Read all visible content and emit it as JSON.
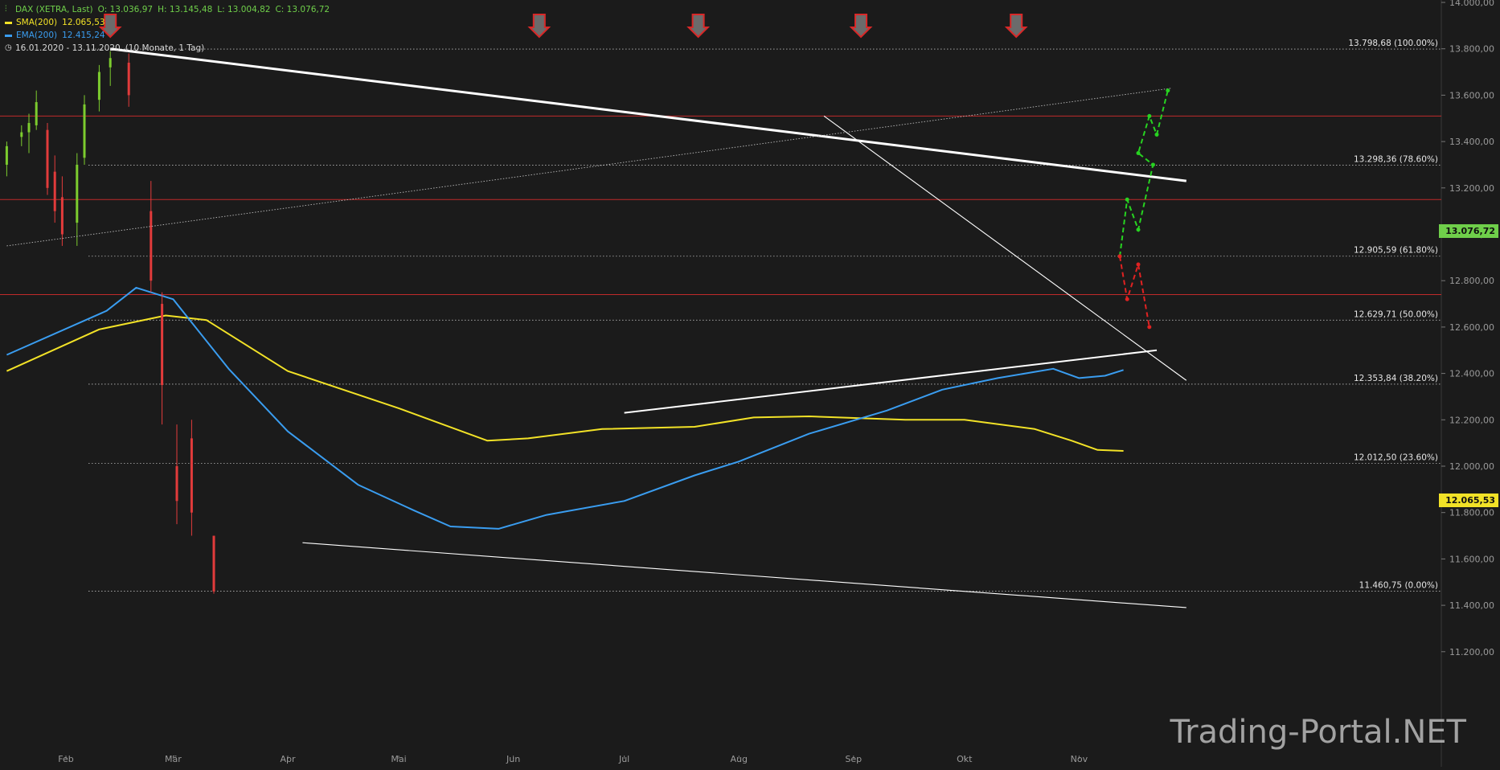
{
  "legend": {
    "instrument": "DAX (XETRA, Last)",
    "open": "O: 13.036,97",
    "high": "H: 13.145,48",
    "low": "L: 13.004,82",
    "close": "C: 13.076,72",
    "sma_label": "SMA(200)",
    "sma_value": "12.065,53",
    "ema_label": "EMA(200)",
    "ema_value": "12.415,24",
    "range": "16.01.2020 - 13.11.2020",
    "range_detail": "(10 Monate, 1 Tag)"
  },
  "watermark": "Trading-Portal.NET",
  "last_price_tag": "13.076,72",
  "sma_price_tag": "12.065,53",
  "colors": {
    "background": "#1b1b1b",
    "up": "#7ccc2e",
    "down": "#e23b3b",
    "sma": "#f2e227",
    "ema": "#3a9df0",
    "grid_fib": "#b8b8b8",
    "resistance": "#c02a2a",
    "trend": "#ffffff",
    "projection_up": "#27d321",
    "projection_down": "#e02222"
  },
  "chart_data": {
    "type": "candlestick",
    "y_axis": {
      "min": 11150,
      "max": 14000,
      "ticks": [
        11200,
        11400,
        11600,
        11800,
        12000,
        12200,
        12400,
        12600,
        12800,
        13000,
        13200,
        13400,
        13600,
        13800,
        14000
      ],
      "tick_labels": [
        "11.200,00",
        "11.400,00",
        "11.600,00",
        "11.800,00",
        "12.000,00",
        "12.200,00",
        "12.400,00",
        "12.600,00",
        "12.800,00",
        "13.000,00",
        "13.200,00",
        "13.400,00",
        "13.600,00",
        "13.800,00",
        "14.000,00"
      ]
    },
    "x_axis": {
      "labels": [
        "Feb",
        "Mär",
        "Apr",
        "Mai",
        "Jun",
        "Jul",
        "Aug",
        "Sep",
        "Okt",
        "Nov"
      ],
      "label_dates": [
        "2020-02-01",
        "2020-03-01",
        "2020-04-01",
        "2020-05-01",
        "2020-06-01",
        "2020-07-01",
        "2020-08-01",
        "2020-09-01",
        "2020-10-01",
        "2020-11-01"
      ]
    },
    "fibonacci": [
      {
        "value": 13798.68,
        "label": "13.798,68 (100.00%)"
      },
      {
        "value": 13298.36,
        "label": "13.298,36 (78.60%)"
      },
      {
        "value": 12905.59,
        "label": "12.905,59 (61.80%)"
      },
      {
        "value": 12629.71,
        "label": "12.629,71 (50.00%)"
      },
      {
        "value": 12353.84,
        "label": "12.353,84 (38.20%)"
      },
      {
        "value": 12012.5,
        "label": "12.012,50 (23.60%)"
      },
      {
        "value": 11460.75,
        "label": "11.460,75 (0.00%)"
      }
    ],
    "resistance_levels": [
      13510,
      13150,
      12740
    ],
    "trendlines": [
      {
        "from": [
          "2020-02-13",
          13800
        ],
        "to": [
          "2020-11-30",
          13230
        ],
        "style": "thick"
      },
      {
        "from": [
          "2020-07-01",
          12230
        ],
        "to": [
          "2020-11-22",
          12500
        ],
        "style": "medium"
      },
      {
        "from": [
          "2020-04-05",
          11670
        ],
        "to": [
          "2020-11-30",
          11390
        ],
        "style": "thin"
      },
      {
        "from": [
          "2020-08-24",
          13510
        ],
        "to": [
          "2020-11-30",
          12370
        ],
        "style": "thin"
      },
      {
        "from": [
          "2020-01-16",
          12950
        ],
        "to": [
          "2020-11-26",
          13630
        ],
        "style": "dotted"
      }
    ],
    "sma200": [
      [
        "2020-01-16",
        12410
      ],
      [
        "2020-02-10",
        12590
      ],
      [
        "2020-02-28",
        12650
      ],
      [
        "2020-03-10",
        12630
      ],
      [
        "2020-04-01",
        12410
      ],
      [
        "2020-05-01",
        12250
      ],
      [
        "2020-05-25",
        12110
      ],
      [
        "2020-06-05",
        12120
      ],
      [
        "2020-06-25",
        12160
      ],
      [
        "2020-07-20",
        12170
      ],
      [
        "2020-08-05",
        12210
      ],
      [
        "2020-08-20",
        12215
      ],
      [
        "2020-09-15",
        12200
      ],
      [
        "2020-10-01",
        12200
      ],
      [
        "2020-10-20",
        12160
      ],
      [
        "2020-10-30",
        12110
      ],
      [
        "2020-11-06",
        12070
      ],
      [
        "2020-11-13",
        12066
      ]
    ],
    "ema200": [
      [
        "2020-01-16",
        12480
      ],
      [
        "2020-02-12",
        12670
      ],
      [
        "2020-02-20",
        12770
      ],
      [
        "2020-03-01",
        12720
      ],
      [
        "2020-03-16",
        12420
      ],
      [
        "2020-04-01",
        12150
      ],
      [
        "2020-04-20",
        11920
      ],
      [
        "2020-05-05",
        11810
      ],
      [
        "2020-05-15",
        11740
      ],
      [
        "2020-05-28",
        11730
      ],
      [
        "2020-06-10",
        11790
      ],
      [
        "2020-07-01",
        11850
      ],
      [
        "2020-07-20",
        11960
      ],
      [
        "2020-08-01",
        12020
      ],
      [
        "2020-08-20",
        12140
      ],
      [
        "2020-09-10",
        12240
      ],
      [
        "2020-09-25",
        12330
      ],
      [
        "2020-10-10",
        12380
      ],
      [
        "2020-10-25",
        12420
      ],
      [
        "2020-11-01",
        12380
      ],
      [
        "2020-11-08",
        12390
      ],
      [
        "2020-11-13",
        12415
      ]
    ],
    "candles": [
      {
        "d": "2020-01-16",
        "o": 13300,
        "h": 13400,
        "l": 13250,
        "c": 13380
      },
      {
        "d": "2020-01-20",
        "o": 13420,
        "h": 13470,
        "l": 13380,
        "c": 13440
      },
      {
        "d": "2020-01-22",
        "o": 13440,
        "h": 13520,
        "l": 13350,
        "c": 13480
      },
      {
        "d": "2020-01-24",
        "o": 13470,
        "h": 13620,
        "l": 13450,
        "c": 13570
      },
      {
        "d": "2020-01-27",
        "o": 13450,
        "h": 13480,
        "l": 13170,
        "c": 13200
      },
      {
        "d": "2020-01-29",
        "o": 13270,
        "h": 13340,
        "l": 13050,
        "c": 13100
      },
      {
        "d": "2020-01-31",
        "o": 13160,
        "h": 13250,
        "l": 12950,
        "c": 13000
      },
      {
        "d": "2020-02-04",
        "o": 13050,
        "h": 13350,
        "l": 12950,
        "c": 13300
      },
      {
        "d": "2020-02-06",
        "o": 13330,
        "h": 13600,
        "l": 13300,
        "c": 13560
      },
      {
        "d": "2020-02-10",
        "o": 13580,
        "h": 13730,
        "l": 13530,
        "c": 13700
      },
      {
        "d": "2020-02-13",
        "o": 13720,
        "h": 13790,
        "l": 13640,
        "c": 13760
      },
      {
        "d": "2020-02-18",
        "o": 13740,
        "h": 13780,
        "l": 13550,
        "c": 13600
      },
      {
        "d": "2020-02-24",
        "o": 13100,
        "h": 13230,
        "l": 12750,
        "c": 12800
      },
      {
        "d": "2020-02-27",
        "o": 12700,
        "h": 12750,
        "l": 12180,
        "c": 12350
      },
      {
        "d": "2020-03-02",
        "o": 12000,
        "h": 12180,
        "l": 11750,
        "c": 11850
      },
      {
        "d": "2020-03-06",
        "o": 12120,
        "h": 12200,
        "l": 11700,
        "c": 11800
      },
      {
        "d": "2020-03-12",
        "o": 11700,
        "h": 11700,
        "l": 11450,
        "c": 11460
      }
    ],
    "markers_down": [
      "2020-02-13",
      "2020-06-08",
      "2020-07-21",
      "2020-09-03",
      "2020-10-15"
    ],
    "projection_up": [
      [
        "2020-11-12",
        12905
      ],
      [
        "2020-11-14",
        13150
      ],
      [
        "2020-11-17",
        13020
      ],
      [
        "2020-11-21",
        13300
      ],
      [
        "2020-11-17",
        13350
      ],
      [
        "2020-11-20",
        13510
      ],
      [
        "2020-11-22",
        13430
      ],
      [
        "2020-11-25",
        13620
      ]
    ],
    "projection_down": [
      [
        "2020-11-12",
        12905
      ],
      [
        "2020-11-14",
        12720
      ],
      [
        "2020-11-17",
        12870
      ],
      [
        "2020-11-20",
        12600
      ]
    ]
  }
}
